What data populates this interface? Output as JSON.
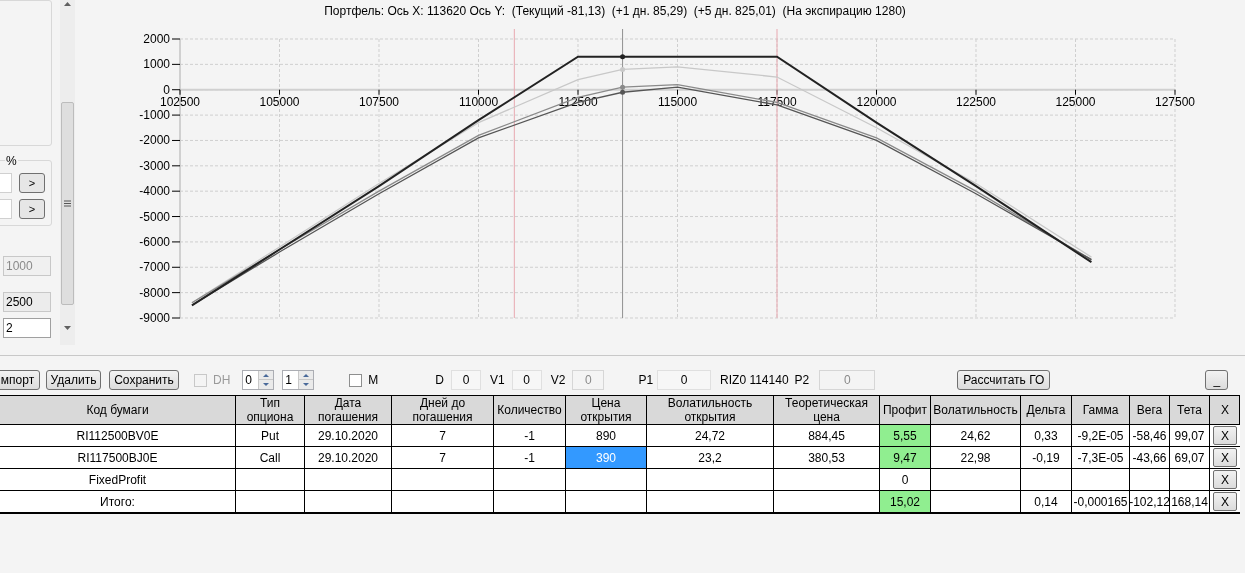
{
  "left_panel": {
    "group_label": "%",
    "arrow_buttons": [
      ">",
      ">"
    ],
    "fields": [
      {
        "value": "1000",
        "disabled": true
      },
      {
        "value": "2500",
        "disabled": false,
        "readonly": true
      },
      {
        "value": "2",
        "disabled": false,
        "readonly": false
      }
    ]
  },
  "chart": {
    "chart_data": {
      "type": "line",
      "title": "Портфель: Ось X: 113620 Ось Y:  (Текущий -81,13)  (+1 дн. 85,29)  (+5 дн. 825,01)  (На экспирацию 1280)",
      "x": [
        102800,
        105000,
        107500,
        110000,
        112500,
        113620,
        115000,
        117500,
        120000,
        122500,
        125400
      ],
      "series": [
        {
          "color": "#c8c8c8",
          "values": [
            -8400,
            -6200,
            -3700,
            -1300,
            400,
            800,
            900,
            500,
            -1500,
            -3700,
            -6600
          ]
        },
        {
          "color": "#8a8a8a",
          "values": [
            -8400,
            -6300,
            -4000,
            -1800,
            -300,
            100,
            200,
            -500,
            -1900,
            -4000,
            -6700
          ]
        },
        {
          "color": "#555555",
          "values": [
            -8500,
            -6400,
            -4100,
            -1900,
            -500,
            -100,
            100,
            -600,
            -2000,
            -4100,
            -6700
          ]
        },
        {
          "color": "#222222",
          "values": [
            -8500,
            -6300,
            -3800,
            -1200,
            1300,
            1300,
            1300,
            1300,
            -1300,
            -3800,
            -6800
          ]
        }
      ],
      "grid": true,
      "xlim": [
        102500,
        127500
      ],
      "ylim": [
        -9000,
        2000
      ],
      "xticks": [
        102500,
        105000,
        107500,
        110000,
        112500,
        115000,
        117500,
        120000,
        122500,
        125000,
        127500
      ],
      "yticks": [
        2000,
        1000,
        0,
        -1000,
        -2000,
        -3000,
        -4000,
        -5000,
        -6000,
        -7000,
        -8000,
        -9000
      ],
      "ref_lines": [
        {
          "axis": "x",
          "value": 110900,
          "color": "#e8a8b0"
        },
        {
          "axis": "x",
          "value": 117500,
          "color": "#e8a8b0"
        },
        {
          "axis": "x",
          "value": 113620,
          "color": "#909090"
        }
      ]
    }
  },
  "toolbar": [
    {
      "kind": "button",
      "label": "мпорт"
    },
    {
      "kind": "button",
      "label": "Удалить"
    },
    {
      "kind": "button",
      "label": "Сохранить"
    },
    {
      "kind": "checkbox",
      "label": "DH",
      "checked": false,
      "disabled": true
    },
    {
      "kind": "spinner",
      "value": "0"
    },
    {
      "kind": "spinner",
      "value": "1"
    },
    {
      "kind": "checkbox",
      "label": "M",
      "checked": false,
      "disabled": false
    },
    {
      "kind": "label",
      "text": "D"
    },
    {
      "kind": "field",
      "value": "0",
      "disabled": false
    },
    {
      "kind": "label",
      "text": "V1"
    },
    {
      "kind": "field",
      "value": "0",
      "disabled": false
    },
    {
      "kind": "label",
      "text": "V2"
    },
    {
      "kind": "field",
      "value": "0",
      "disabled": true
    },
    {
      "kind": "label",
      "text": "P1"
    },
    {
      "kind": "field",
      "value": "0",
      "disabled": false
    },
    {
      "kind": "label",
      "text": "RIZ0 114140"
    },
    {
      "kind": "label",
      "text": "P2"
    },
    {
      "kind": "field",
      "value": "0",
      "disabled": true
    },
    {
      "kind": "button",
      "label": "Рассчитать ГО"
    },
    {
      "kind": "button",
      "label": "_"
    }
  ],
  "table": {
    "columns": [
      "Код бумаги",
      "Тип опциона",
      "Дата погашения",
      "Дней до погашения",
      "Количество",
      "Цена открытия",
      "Волатильность открытия",
      "Теоретическая цена",
      "Профит",
      "Волатильность",
      "Дельта",
      "Гамма",
      "Вега",
      "Тета",
      "X"
    ],
    "rows": [
      {
        "delete": "X",
        "cells": [
          {
            "text": "RI112500BV0E",
            "selected": false
          },
          {
            "text": "Put",
            "selected": false
          },
          {
            "text": "29.10.2020",
            "selected": false
          },
          {
            "text": "7",
            "selected": false
          },
          {
            "text": "-1",
            "selected": false
          },
          {
            "text": "890",
            "selected": false
          },
          {
            "text": "24,72",
            "selected": false
          },
          {
            "text": "884,45",
            "selected": false
          },
          {
            "text": "5,55",
            "selected": false,
            "color": "#90ee90"
          },
          {
            "text": "24,62",
            "selected": false
          },
          {
            "text": "0,33",
            "selected": false
          },
          {
            "text": "-9,2E-05",
            "selected": false
          },
          {
            "text": "-58,46",
            "selected": false
          },
          {
            "text": "99,07",
            "selected": false
          }
        ]
      },
      {
        "delete": "X",
        "cells": [
          {
            "text": "RI117500BJ0E",
            "selected": false
          },
          {
            "text": "Call",
            "selected": false
          },
          {
            "text": "29.10.2020",
            "selected": false
          },
          {
            "text": "7",
            "selected": false
          },
          {
            "text": "-1",
            "selected": false
          },
          {
            "text": "390",
            "selected": true
          },
          {
            "text": "23,2",
            "selected": false
          },
          {
            "text": "380,53",
            "selected": false
          },
          {
            "text": "9,47",
            "selected": false,
            "color": "#90ee90"
          },
          {
            "text": "22,98",
            "selected": false
          },
          {
            "text": "-0,19",
            "selected": false
          },
          {
            "text": "-7,3E-05",
            "selected": false
          },
          {
            "text": "-43,66",
            "selected": false
          },
          {
            "text": "69,07",
            "selected": false
          }
        ]
      },
      {
        "delete": "X",
        "cells": [
          {
            "text": "FixedProfit",
            "selected": false
          },
          null,
          null,
          null,
          null,
          null,
          null,
          null,
          {
            "text": "0",
            "selected": false
          },
          null,
          null,
          null,
          null,
          null
        ]
      },
      {
        "delete": "X",
        "cells": [
          {
            "text": "Итого:",
            "selected": false
          },
          null,
          null,
          null,
          null,
          null,
          null,
          null,
          {
            "text": "15,02",
            "selected": false,
            "color": "#90ee90"
          },
          null,
          {
            "text": "0,14",
            "selected": false
          },
          {
            "text": "-0,000165",
            "selected": false
          },
          {
            "text": "-102,12",
            "selected": false
          },
          {
            "text": "168,14",
            "selected": false
          }
        ]
      }
    ]
  }
}
